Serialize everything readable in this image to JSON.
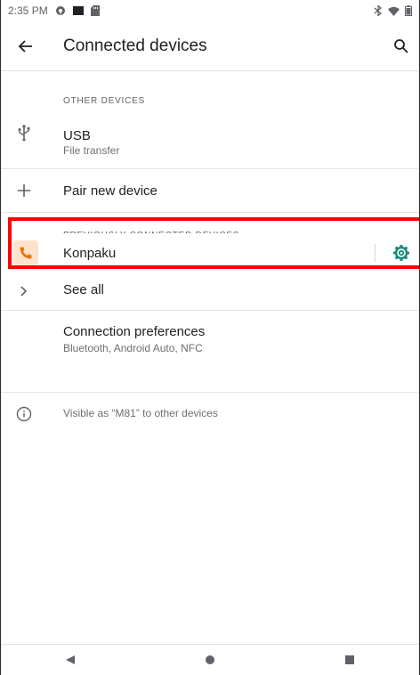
{
  "status_bar": {
    "time": "2:35 PM",
    "icons_left": [
      "vpn-key-icon",
      "black-square-icon",
      "sd-card-icon"
    ],
    "icons_right": [
      "bluetooth-icon",
      "wifi-icon",
      "battery-icon"
    ]
  },
  "app_bar": {
    "title": "Connected devices",
    "back_icon": "arrow-back-icon",
    "search_icon": "search-icon"
  },
  "other_devices": {
    "header": "OTHER DEVICES",
    "usb": {
      "title": "USB",
      "subtitle": "File transfer",
      "icon": "usb-icon"
    },
    "pair": {
      "title": "Pair new device",
      "icon": "plus-icon"
    }
  },
  "previously_connected": {
    "header": "PREVIOUSLY CONNECTED DEVICES",
    "device": {
      "name": "Konpaku",
      "icon": "phone-icon",
      "settings_icon": "gear-icon"
    },
    "see_all": {
      "title": "See all",
      "icon": "chevron-right-icon"
    }
  },
  "connection_preferences": {
    "title": "Connection preferences",
    "subtitle": "Bluetooth, Android Auto, NFC"
  },
  "visibility": {
    "text": "Visible as “M81” to other devices",
    "icon": "info-icon"
  },
  "nav_bar": {
    "buttons": [
      "back-triangle-icon",
      "home-circle-icon",
      "recents-square-icon"
    ]
  },
  "colors": {
    "accent": "#1a8a7a",
    "highlight": "#ff0000",
    "phone_badge_bg": "#fde3cc",
    "phone_icon": "#e8710a"
  }
}
